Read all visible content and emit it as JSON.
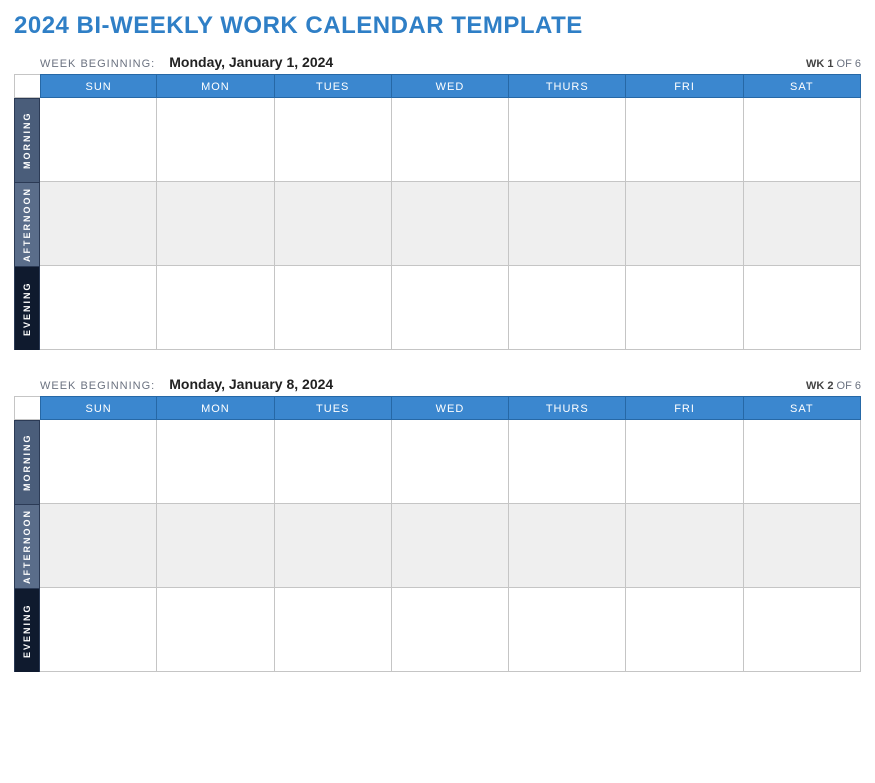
{
  "title": "2024 BI-WEEKLY WORK CALENDAR TEMPLATE",
  "weekBeginningLabel": "WEEK BEGINNING:",
  "weekLabelPrefix": "WK",
  "weekOf": "OF",
  "totalWeeks": "6",
  "days": [
    "SUN",
    "MON",
    "TUES",
    "WED",
    "THURS",
    "FRI",
    "SAT"
  ],
  "periods": {
    "morning": "MORNING",
    "afternoon": "AFTERNOON",
    "evening": "EVENING"
  },
  "weeks": [
    {
      "date": "Monday, January 1, 2024",
      "number": "1"
    },
    {
      "date": "Monday, January 8, 2024",
      "number": "2"
    }
  ]
}
